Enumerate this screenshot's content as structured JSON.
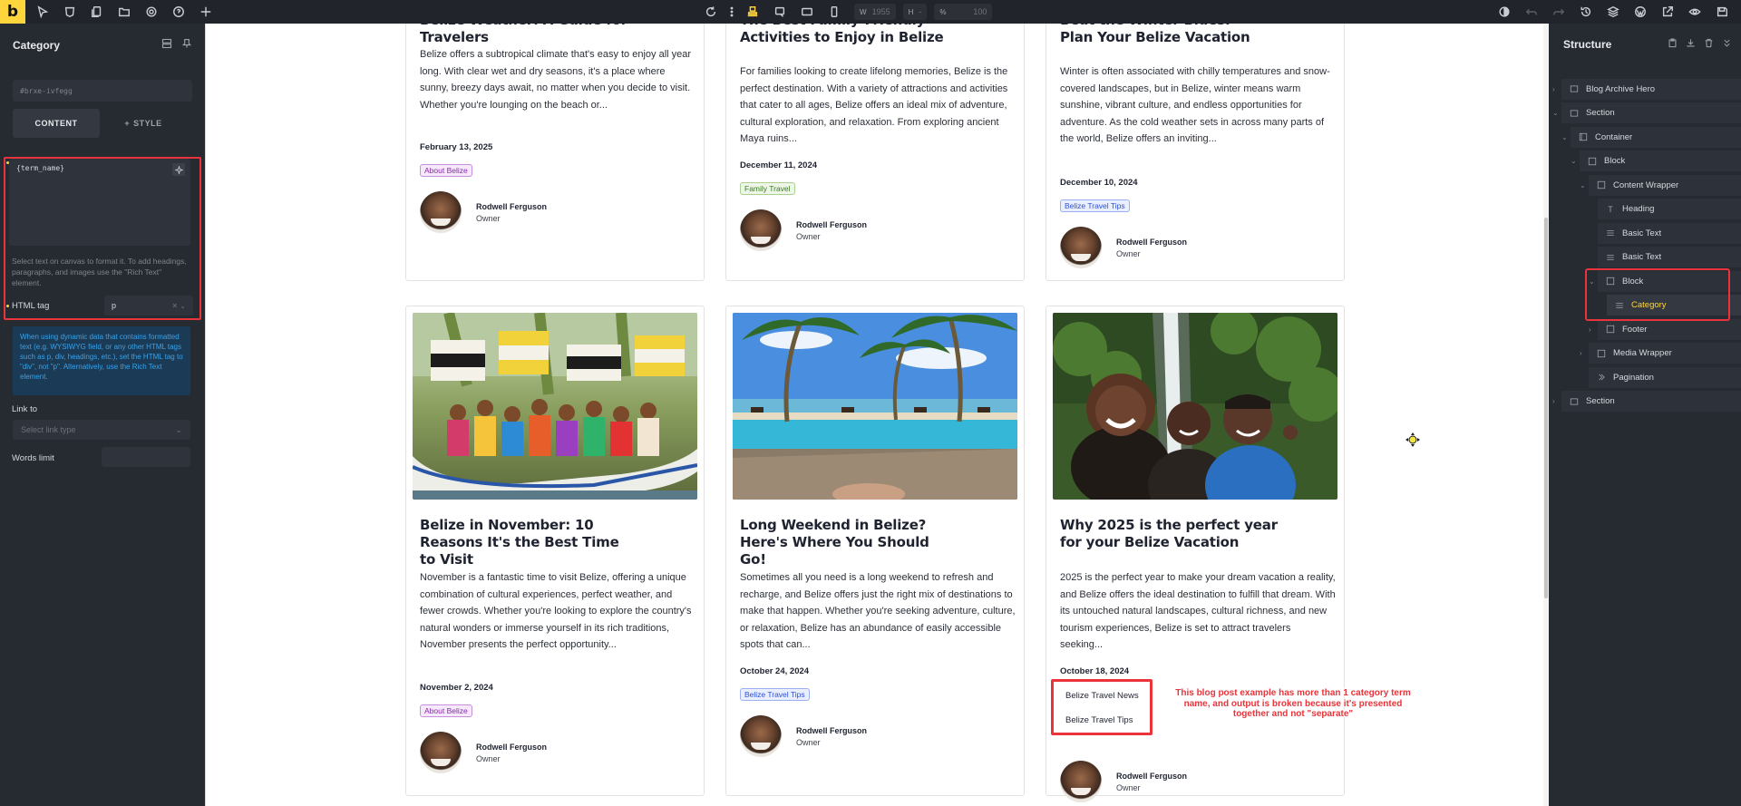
{
  "toolbar": {
    "width_label": "W",
    "width_value": "1955",
    "height_label": "H",
    "height_value": "-",
    "zoom_label": "%",
    "zoom_value": "100"
  },
  "left_panel": {
    "title": "Category",
    "css_id": "#brxe-ivfegg",
    "tabs": [
      {
        "label": "CONTENT",
        "active": true
      },
      {
        "label": "STYLE",
        "active": false
      }
    ],
    "text_value": "{term_name}",
    "help_text": "Select text on canvas to format it. To add headings, paragraphs, and images use the \"Rich Text\" element.",
    "html_tag_label": "HTML tag",
    "html_tag_value": "p",
    "info_text": "When using dynamic data that contains formatted text (e.g. WYSIWYG field, or any other HTML tags such as p, div, headings, etc.), set the HTML tag to \"div\", not \"p\". Alternatively, use the Rich Text element.",
    "link_to_label": "Link to",
    "link_type_placeholder": "Select link type",
    "words_limit_label": "Words limit"
  },
  "cards": [
    {
      "title": "Belize Weather: A Guide for Travelers",
      "excerpt": "Belize offers a subtropical climate that's easy to enjoy all year long. With clear wet and dry seasons, it's a place where sunny, breezy days await, no matter when you decide to visit. Whether you're lounging on the beach or...",
      "date": "February 13, 2025",
      "tags": [
        "About Belize"
      ],
      "author": "Rodwell Ferguson",
      "role": "Owner"
    },
    {
      "title": "The Best Family-Friendly Activities to Enjoy in Belize",
      "excerpt": "For families looking to create lifelong memories, Belize is the perfect destination. With a variety of attractions and activities that cater to all ages, Belize offers an ideal mix of adventure, cultural exploration, and relaxation. From exploring ancient Maya ruins...",
      "date": "December 11, 2024",
      "tags": [
        "Family Travel"
      ],
      "author": "Rodwell Ferguson",
      "role": "Owner"
    },
    {
      "title": "Beat the Winter Blues: Plan Your Belize Vacation",
      "excerpt": "Winter is often associated with chilly temperatures and snow-covered landscapes, but in Belize, winter means warm sunshine, vibrant culture, and endless opportunities for adventure. As the cold weather sets in across many parts of the world, Belize offers an inviting...",
      "date": "December 10, 2024",
      "tags": [
        "Belize Travel Tips"
      ],
      "author": "Rodwell Ferguson",
      "role": "Owner"
    },
    {
      "title": "Belize in November: 10 Reasons It's the Best Time to Visit",
      "excerpt": "November is a fantastic time to visit Belize, offering a unique combination of cultural experiences, perfect weather, and fewer crowds. Whether you're looking to explore the country's natural wonders or immerse yourself in its rich traditions, November presents the perfect opportunity...",
      "date": "November 2, 2024",
      "tags": [
        "About Belize"
      ],
      "author": "Rodwell Ferguson",
      "role": "Owner"
    },
    {
      "title": "Long Weekend in Belize? Here's Where You Should Go!",
      "excerpt": "Sometimes all you need is a long weekend to refresh and recharge, and Belize offers just the right mix of destinations to make that happen. Whether you're seeking adventure, culture, or relaxation, Belize has an abundance of easily accessible spots that can...",
      "date": "October 24, 2024",
      "tags": [
        "Belize Travel Tips"
      ],
      "author": "Rodwell Ferguson",
      "role": "Owner"
    },
    {
      "title": "Why 2025 is the perfect year for your Belize Vacation",
      "excerpt": "2025 is the perfect year to make your dream vacation a reality, and Belize offers the ideal destination to fulfill that dream. With its untouched natural landscapes, cultural richness, and new tourism experiences, Belize is set to attract travelers seeking...",
      "date": "October 18, 2024",
      "tags": [
        "Belize Travel News",
        "Belize Travel Tips"
      ],
      "author": "Rodwell Ferguson",
      "role": "Owner"
    }
  ],
  "annotation": "This blog post example has more than 1 category term name, and output is broken because it's presented together and not \"separate\"",
  "structure": {
    "title": "Structure",
    "items": [
      {
        "label": "Blog Archive Hero",
        "icon": "section-icon"
      },
      {
        "label": "Section",
        "icon": "section-icon"
      },
      {
        "label": "Container",
        "icon": "container-icon"
      },
      {
        "label": "Block",
        "icon": "block-icon"
      },
      {
        "label": "Content Wrapper",
        "icon": "block-icon"
      },
      {
        "label": "Heading",
        "icon": "heading-icon"
      },
      {
        "label": "Basic Text",
        "icon": "text-icon"
      },
      {
        "label": "Basic Text",
        "icon": "text-icon"
      },
      {
        "label": "Block",
        "icon": "block-icon"
      },
      {
        "label": "Category",
        "icon": "text-icon"
      },
      {
        "label": "Footer",
        "icon": "block-icon"
      },
      {
        "label": "Media Wrapper",
        "icon": "block-icon"
      },
      {
        "label": "Pagination",
        "icon": "pagination-icon"
      },
      {
        "label": "Section",
        "icon": "section-icon"
      }
    ]
  },
  "colors": {
    "accent": "#ffd53e",
    "annotation_red": "#e8343a",
    "panel_bg": "#262a31",
    "info_blue": "#3aa3ea"
  }
}
